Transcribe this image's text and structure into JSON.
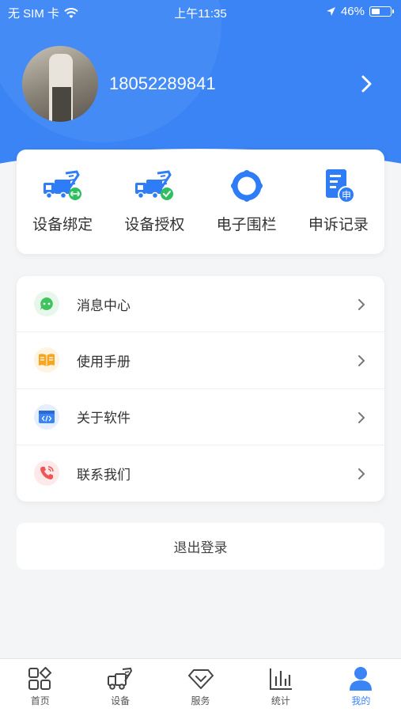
{
  "status_bar": {
    "carrier": "无 SIM 卡",
    "time": "上午11:35",
    "battery": "46%",
    "battery_level": 0.46
  },
  "profile": {
    "phone": "18052289841"
  },
  "quick_actions": [
    {
      "label": "设备绑定",
      "icon": "truck-link-icon"
    },
    {
      "label": "设备授权",
      "icon": "truck-check-icon"
    },
    {
      "label": "电子围栏",
      "icon": "geofence-icon"
    },
    {
      "label": "申诉记录",
      "icon": "appeal-record-icon",
      "badge": "申"
    }
  ],
  "menu": [
    {
      "label": "消息中心",
      "icon": "message-icon",
      "color": "#3fc35c"
    },
    {
      "label": "使用手册",
      "icon": "manual-icon",
      "color": "#f5a623"
    },
    {
      "label": "关于软件",
      "icon": "software-icon",
      "color": "#3a84f5"
    },
    {
      "label": "联系我们",
      "icon": "phone-icon",
      "color": "#f05454"
    }
  ],
  "logout_label": "退出登录",
  "tabs": [
    {
      "label": "首页",
      "icon": "home-grid-icon"
    },
    {
      "label": "设备",
      "icon": "device-truck-icon"
    },
    {
      "label": "服务",
      "icon": "service-diamond-icon"
    },
    {
      "label": "统计",
      "icon": "stats-bar-icon"
    },
    {
      "label": "我的",
      "icon": "user-icon",
      "active": true
    }
  ],
  "colors": {
    "primary": "#3a84f5",
    "background": "#f4f5f7"
  }
}
